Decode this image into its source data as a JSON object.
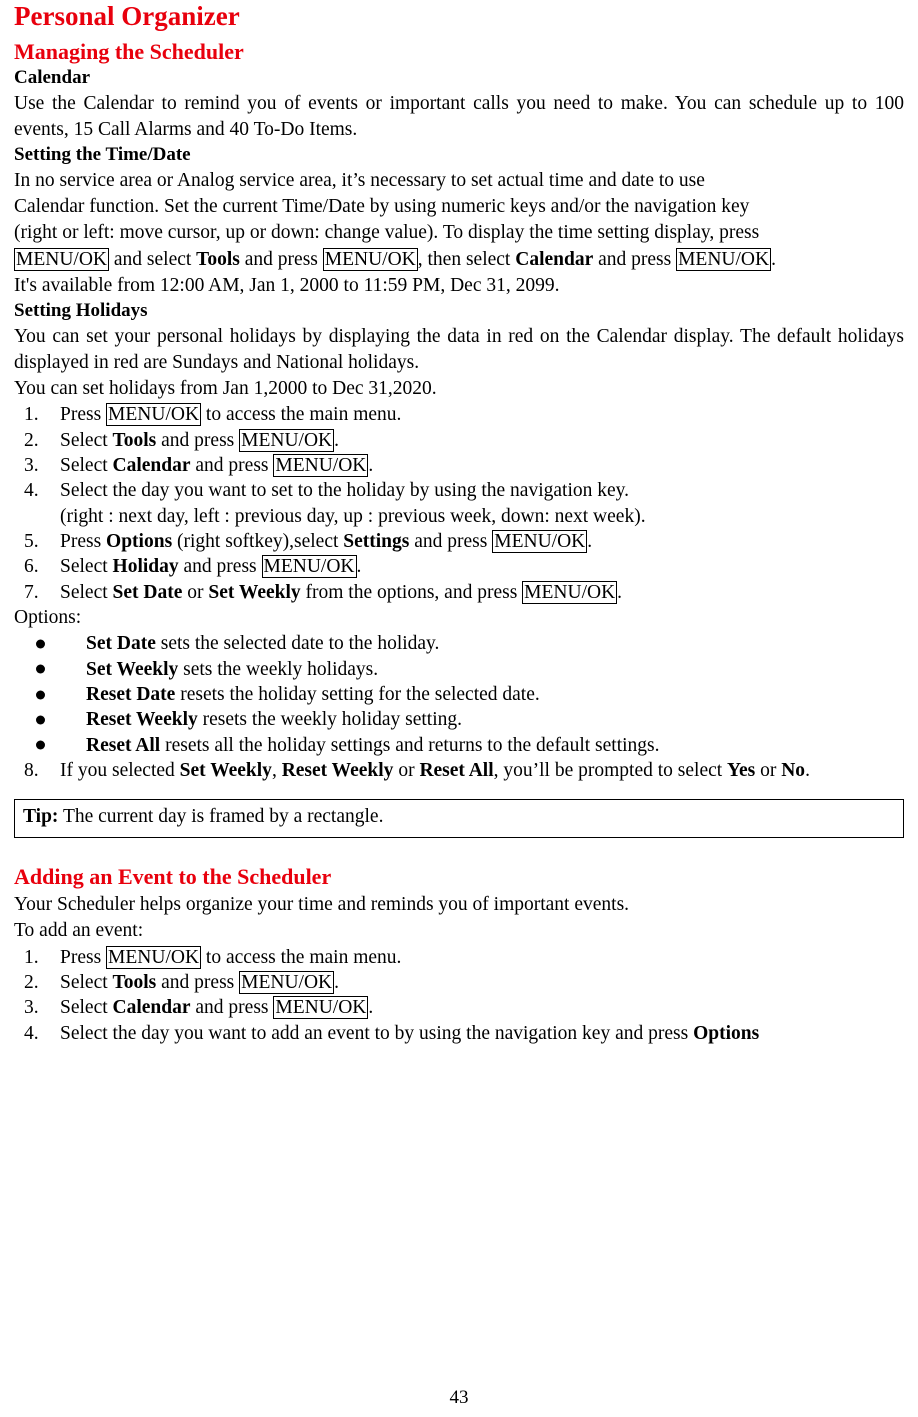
{
  "document": {
    "title": "Personal Organizer",
    "page_number": "43",
    "section1": {
      "heading": "Managing the Scheduler",
      "sub1": {
        "heading": "Calendar",
        "para": "Use the Calendar to remind you of events or important calls you need to make. You can schedule up to 100 events, 15 Call Alarms and 40 To-Do Items."
      },
      "sub2": {
        "heading": "Setting the Time/Date",
        "line1": "In no service area or Analog service area, it’s necessary to set actual time and date to use",
        "line2": "Calendar function. Set the current Time/Date by using numeric keys and/or the navigation key",
        "line3": "(right or left: move cursor, up or down: change value). To display the time setting display, press",
        "line4_a": "MENU/OK",
        "line4_b": " and select ",
        "line4_c": "Tools",
        "line4_d": " and press ",
        "line4_e": "MENU/OK",
        "line4_f": ", then select ",
        "line4_g": "Calendar",
        "line4_h": " and press ",
        "line4_i": "MENU/OK",
        "line4_j": ".",
        "line5": "It's available from 12:00 AM, Jan 1, 2000 to 11:59 PM, Dec 31, 2099."
      },
      "sub3": {
        "heading": "Setting Holidays",
        "para1": "You can set your personal holidays by displaying the data in red on the Calendar display. The default holidays displayed in red are Sundays and National holidays.",
        "para2": "You can set holidays from Jan 1,2000 to Dec 31,2020.",
        "steps": [
          {
            "num": "1.",
            "parts": [
              {
                "t": "Press ",
                "s": "plain"
              },
              {
                "t": "MENU/OK",
                "s": "key"
              },
              {
                "t": " to access the main menu.",
                "s": "plain"
              }
            ]
          },
          {
            "num": "2.",
            "parts": [
              {
                "t": "Select ",
                "s": "plain"
              },
              {
                "t": "Tools",
                "s": "bold"
              },
              {
                "t": " and press ",
                "s": "plain"
              },
              {
                "t": "MENU/OK",
                "s": "key"
              },
              {
                "t": ".",
                "s": "plain"
              }
            ]
          },
          {
            "num": "3.",
            "parts": [
              {
                "t": "Select ",
                "s": "plain"
              },
              {
                "t": "Calendar",
                "s": "bold"
              },
              {
                "t": " and press ",
                "s": "plain"
              },
              {
                "t": "MENU/OK",
                "s": "key"
              },
              {
                "t": ".",
                "s": "plain"
              }
            ]
          },
          {
            "num": "4.",
            "parts": [
              {
                "t": "Select the day you want to set to the holiday by using the navigation key.",
                "s": "plain"
              }
            ]
          }
        ],
        "step4_sub": "(right : next day, left : previous day, up : previous week, down: next week).",
        "steps2": [
          {
            "num": "5.",
            "parts": [
              {
                "t": "Press ",
                "s": "plain"
              },
              {
                "t": "Options",
                "s": "bold"
              },
              {
                "t": " (right softkey),select ",
                "s": "plain"
              },
              {
                "t": "Settings",
                "s": "bold"
              },
              {
                "t": " and press ",
                "s": "plain"
              },
              {
                "t": "MENU/OK",
                "s": "key"
              },
              {
                "t": ".",
                "s": "plain"
              }
            ]
          },
          {
            "num": "6.",
            "parts": [
              {
                "t": "Select ",
                "s": "plain"
              },
              {
                "t": "Holiday",
                "s": "bold"
              },
              {
                "t": " and press ",
                "s": "plain"
              },
              {
                "t": "MENU/OK",
                "s": "key"
              },
              {
                "t": ".",
                "s": "plain"
              }
            ]
          },
          {
            "num": "7.",
            "parts": [
              {
                "t": "Select ",
                "s": "plain"
              },
              {
                "t": "Set Date",
                "s": "bold"
              },
              {
                "t": " or ",
                "s": "plain"
              },
              {
                "t": "Set Weekly",
                "s": "bold"
              },
              {
                "t": " from the options, and press ",
                "s": "plain"
              },
              {
                "t": "MENU/OK",
                "s": "key"
              },
              {
                "t": ".",
                "s": "plain"
              }
            ]
          }
        ],
        "options_label": "Options:",
        "options": [
          {
            "term": "Set Date",
            "desc": " sets the selected date to the holiday."
          },
          {
            "term": "Set Weekly",
            "desc": " sets the weekly holidays."
          },
          {
            "term": "Reset Date",
            "desc": " resets the holiday setting for the selected date."
          },
          {
            "term": "Reset Weekly",
            "desc": " resets the weekly holiday setting."
          },
          {
            "term": "Reset All",
            "desc": " resets all the holiday settings and returns to the default settings."
          }
        ],
        "step8": {
          "num": "8.",
          "parts": [
            {
              "t": "If you selected ",
              "s": "plain"
            },
            {
              "t": "Set Weekly",
              "s": "bold"
            },
            {
              "t": ", ",
              "s": "plain"
            },
            {
              "t": "Reset Weekly",
              "s": "bold"
            },
            {
              "t": " or ",
              "s": "plain"
            },
            {
              "t": "Reset All",
              "s": "bold"
            },
            {
              "t": ", you’ll be prompted to select ",
              "s": "plain"
            },
            {
              "t": "Yes",
              "s": "bold"
            },
            {
              "t": " or ",
              "s": "plain"
            },
            {
              "t": "No",
              "s": "bold"
            },
            {
              "t": ".",
              "s": "plain"
            }
          ]
        }
      },
      "tip": {
        "label": "Tip:",
        "text": " The current day is framed by a rectangle."
      }
    },
    "section2": {
      "heading": "Adding an Event to the Scheduler",
      "para1": "Your Scheduler helps organize your time and reminds you of important events.",
      "para2": "To add an event:",
      "steps": [
        {
          "num": "1.",
          "parts": [
            {
              "t": "Press ",
              "s": "plain"
            },
            {
              "t": "MENU/OK",
              "s": "key"
            },
            {
              "t": " to access the main menu.",
              "s": "plain"
            }
          ]
        },
        {
          "num": "2.",
          "parts": [
            {
              "t": "Select ",
              "s": "plain"
            },
            {
              "t": "Tools",
              "s": "bold"
            },
            {
              "t": " and press ",
              "s": "plain"
            },
            {
              "t": "MENU/OK",
              "s": "key"
            },
            {
              "t": ".",
              "s": "plain"
            }
          ]
        },
        {
          "num": "3.",
          "parts": [
            {
              "t": "Select ",
              "s": "plain"
            },
            {
              "t": "Calendar",
              "s": "bold"
            },
            {
              "t": " and press ",
              "s": "plain"
            },
            {
              "t": "MENU/OK",
              "s": "key"
            },
            {
              "t": ".",
              "s": "plain"
            }
          ]
        },
        {
          "num": "4.",
          "parts": [
            {
              "t": "Select the day you want to add an event to by using the navigation key and press ",
              "s": "plain"
            },
            {
              "t": "Options",
              "s": "bold"
            }
          ]
        }
      ]
    },
    "colors": {
      "heading_red": "#e8000d",
      "body_black": "#000000",
      "page_bg": "#ffffff"
    }
  }
}
